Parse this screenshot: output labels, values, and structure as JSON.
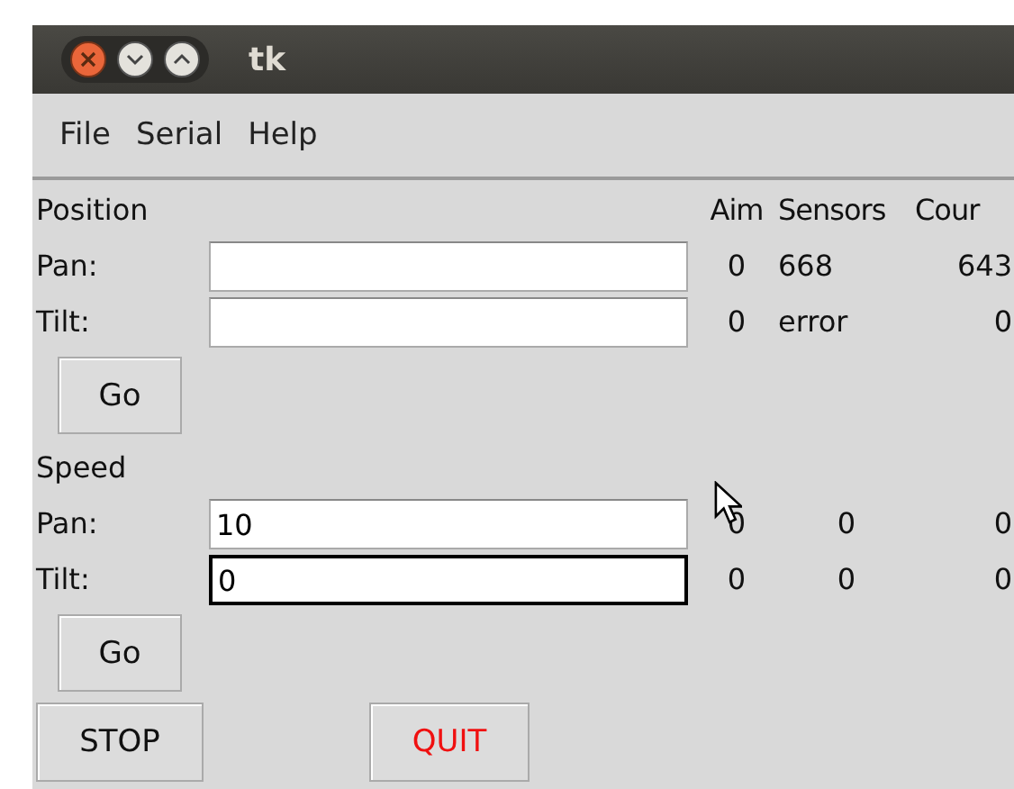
{
  "window": {
    "title": "tk"
  },
  "menu": [
    "File",
    "Serial",
    "Help"
  ],
  "columns": [
    "Aim",
    "Sensors",
    "Cour"
  ],
  "sections": [
    {
      "heading": "Position",
      "rows": [
        {
          "label": "Pan:",
          "focused": false,
          "aim": "0",
          "sensors": "668",
          "counts": "643"
        },
        {
          "label": "Tilt:",
          "focused": false,
          "aim": "0",
          "sensors": "error",
          "counts": "0"
        }
      ],
      "go": "Go"
    },
    {
      "heading": "Speed",
      "rows": [
        {
          "label": "Pan:",
          "value": "10",
          "focused": false,
          "aim": "0",
          "sensors": "0",
          "counts": "0",
          "cursor": true
        },
        {
          "label": "Tilt:",
          "value": "0",
          "focused": true,
          "aim": "0",
          "sensors": "0",
          "counts": "0"
        }
      ],
      "go": "Go"
    }
  ],
  "buttons": [
    {
      "label": "STOP",
      "kind": "stop"
    },
    {
      "label": "QUIT",
      "kind": "quit"
    }
  ]
}
